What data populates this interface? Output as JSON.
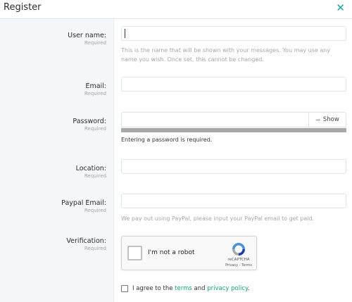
{
  "header": {
    "title": "Register",
    "close_icon": "close-icon"
  },
  "fields": {
    "username": {
      "label": "User name:",
      "required": "Required",
      "value": "",
      "placeholder": "",
      "hint": "This is the name that will be shown with your messages. You may use any name you wish. Once set, this cannot be changed."
    },
    "email": {
      "label": "Email:",
      "required": "Required",
      "value": ""
    },
    "password": {
      "label": "Password:",
      "required": "Required",
      "value": "",
      "show_label": "Show",
      "message": "Entering a password is required."
    },
    "location": {
      "label": "Location:",
      "required": "Required",
      "value": ""
    },
    "paypal": {
      "label": "Paypal Email:",
      "required": "Required",
      "value": "",
      "hint": "We pay out using PayPal, please input your PayPal email to get paid."
    },
    "verification": {
      "label": "Verification:",
      "required": "Required",
      "captcha_text": "I'm not a robot",
      "captcha_brand": "reCAPTCHA",
      "captcha_links": "Privacy - Terms"
    }
  },
  "agree": {
    "prefix": "I agree to the",
    "terms": "terms",
    "and": "and",
    "privacy": "privacy policy",
    "suffix": "."
  },
  "colors": {
    "accent": "#16a086",
    "sidebar_bg": "#f5f8fa",
    "meter": "#a8a8a8"
  }
}
